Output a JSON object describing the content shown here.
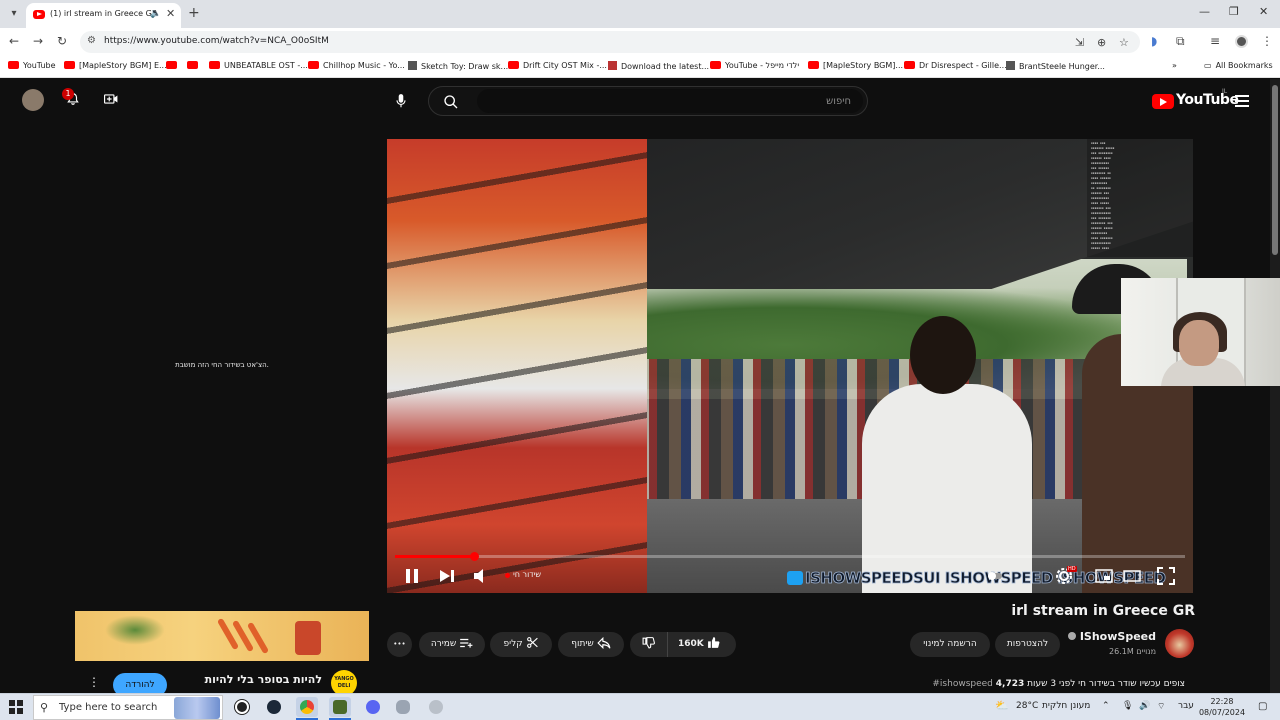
{
  "browser": {
    "tab": {
      "title": "(1) irl stream in Greece GR"
    },
    "url": "https://www.youtube.com/watch?v=NCA_O0oSItM",
    "bookmarks": [
      "YouTube",
      "[MapleStory BGM] E...",
      "UNBEATABLE OST -...",
      "Chillhop Music - Yo...",
      "Sketch Toy: Draw sk...",
      "Drift City OST Mix -...",
      "Download the latest...",
      "YouTube - ילדי מייפל",
      "[MapleStory BGM]...",
      "Dr Disrespect - Gille...",
      "BrantSteele Hunger..."
    ],
    "all_bookmarks": "All Bookmarks"
  },
  "youtube": {
    "notif_count": "1",
    "search_placeholder": "חיפוש",
    "logo": "YouTube",
    "logo_country": "IL",
    "chat_disabled": "הצ'אט בשידור החי הזה מושבת.",
    "player": {
      "live_label": "שידור חי",
      "progress": 0.1,
      "watermark": "ISHOWSPEEDSUI  ISHOWSPEED  ISHOWSPEED",
      "hd_badge": "HD"
    },
    "video": {
      "title": "irl stream in Greece GR",
      "channel": "IShowSpeed",
      "subscribers": "26.1M מנויים",
      "join_label": "להצטרפות",
      "subscribe_label": "הרשמה למינוי",
      "likes": "160K",
      "share_label": "שיתוף",
      "clip_label": "קליפ",
      "save_label": "שמירה",
      "more_label": "•••",
      "viewers": "4,723",
      "stats_text": "צופים עכשיו  שודר בשידור חי לפני 3 שעות",
      "hashtag": "#ishowspeed"
    },
    "ad": {
      "text": "להיות בסופר בלי להיות",
      "button": "להורדה",
      "logo_line1": "YANGO",
      "logo_line2": "DELI"
    }
  },
  "taskbar": {
    "search_placeholder": "Type here to search",
    "weather": "28°C",
    "weather_desc": "מעונן חלקית",
    "lang": "עבר",
    "time": "22:28",
    "date": "08/07/2024"
  }
}
